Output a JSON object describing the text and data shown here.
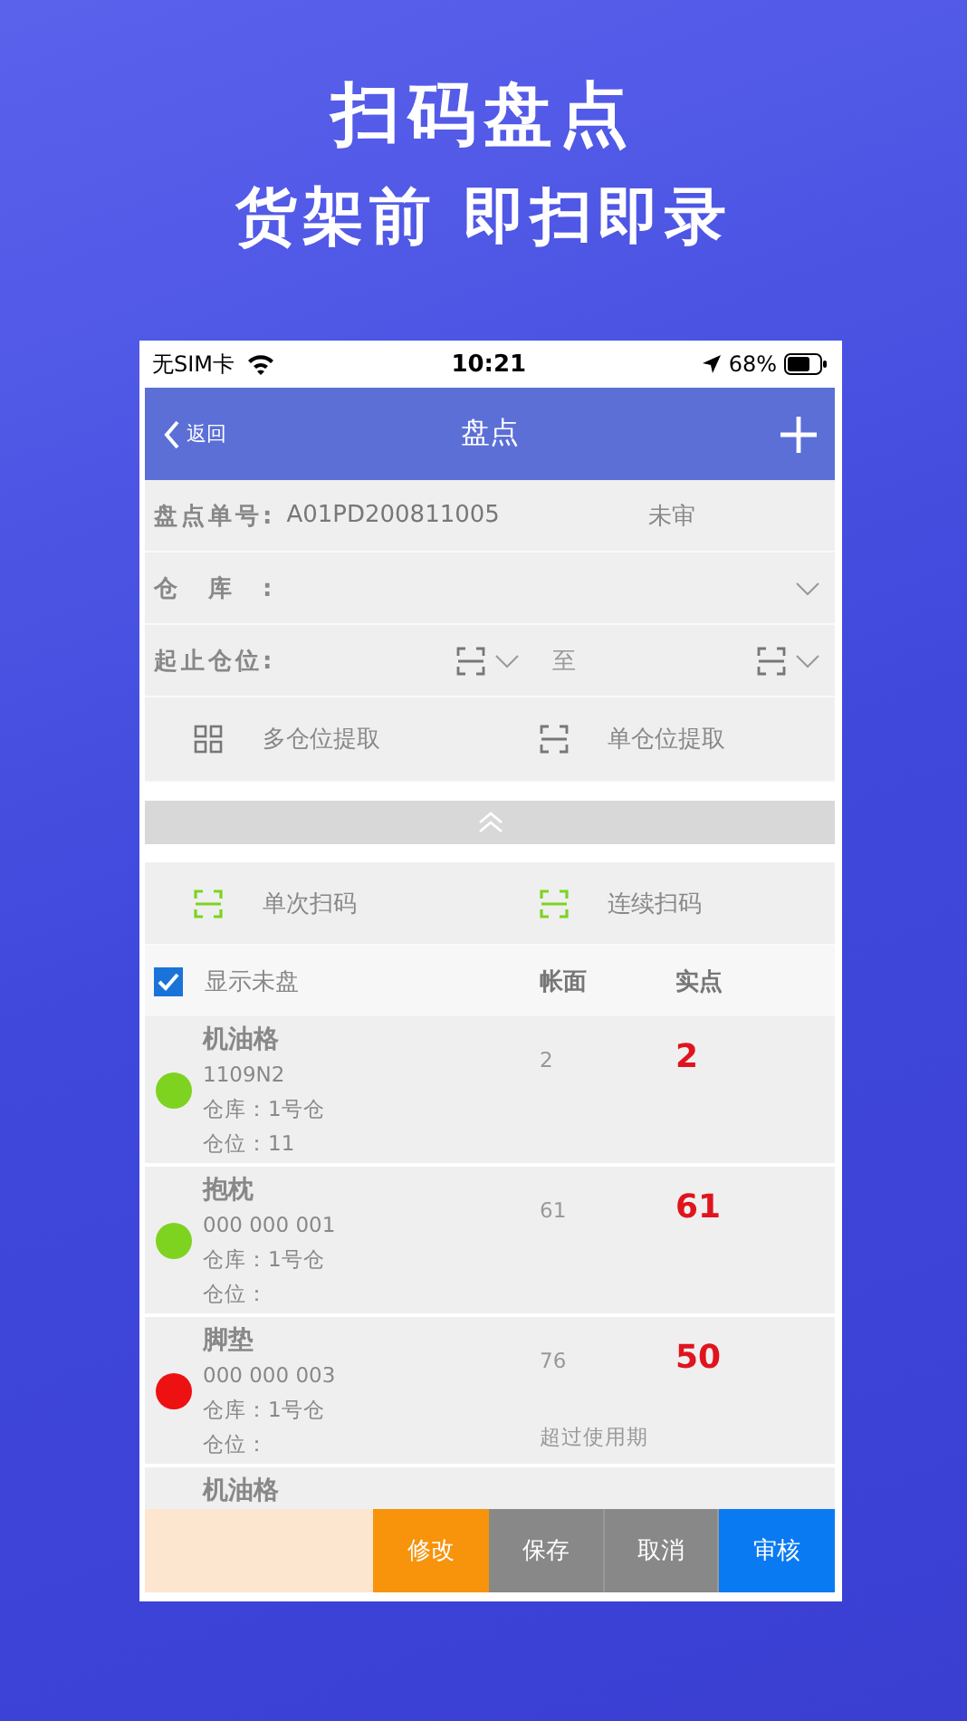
{
  "headline": "扫码盘点",
  "subheadline": "货架前 即扫即录",
  "status_bar": {
    "carrier": "无SIM卡",
    "time": "10:21",
    "battery": "68%"
  },
  "nav": {
    "back": "返回",
    "title": "盘点"
  },
  "form": {
    "order_label": "盘点单号:",
    "order_no": "A01PD200811005",
    "status": "未审",
    "warehouse_label": "仓　库　:",
    "location_label": "起止仓位:",
    "to": "至"
  },
  "extract_buttons": [
    {
      "label": "多仓位提取",
      "kind": "grid"
    },
    {
      "label": "单仓位提取",
      "kind": "scan"
    }
  ],
  "scan_buttons": [
    {
      "label": "单次扫码"
    },
    {
      "label": "连续扫码"
    }
  ],
  "list_header": {
    "show_unchecked": {
      "label": "显示未盘",
      "checked": true
    },
    "book": "帐面",
    "actual": "实点"
  },
  "items": [
    {
      "name": "机油格",
      "code": "1109N2",
      "warehouse": "仓库：1号仓",
      "location": "仓位：11",
      "book": "2",
      "actual": "2",
      "color": "#7ed321"
    },
    {
      "name": "抱枕",
      "code": "000 000 001",
      "warehouse": "仓库：1号仓",
      "location": "仓位：",
      "book": "61",
      "actual": "61",
      "color": "#7ed321"
    },
    {
      "name": "脚垫",
      "code": "000 000 003",
      "warehouse": "仓库：1号仓",
      "location": "仓位：",
      "book": "76",
      "actual": "50",
      "note": "超过使用期",
      "color": "#ee1111"
    },
    {
      "name": "机油格"
    }
  ],
  "footer_buttons": [
    {
      "label": "修改",
      "kind": "warning"
    },
    {
      "label": "保存",
      "kind": "neutral"
    },
    {
      "label": "取消",
      "kind": "neutral"
    },
    {
      "label": "审核",
      "kind": "primary"
    }
  ]
}
